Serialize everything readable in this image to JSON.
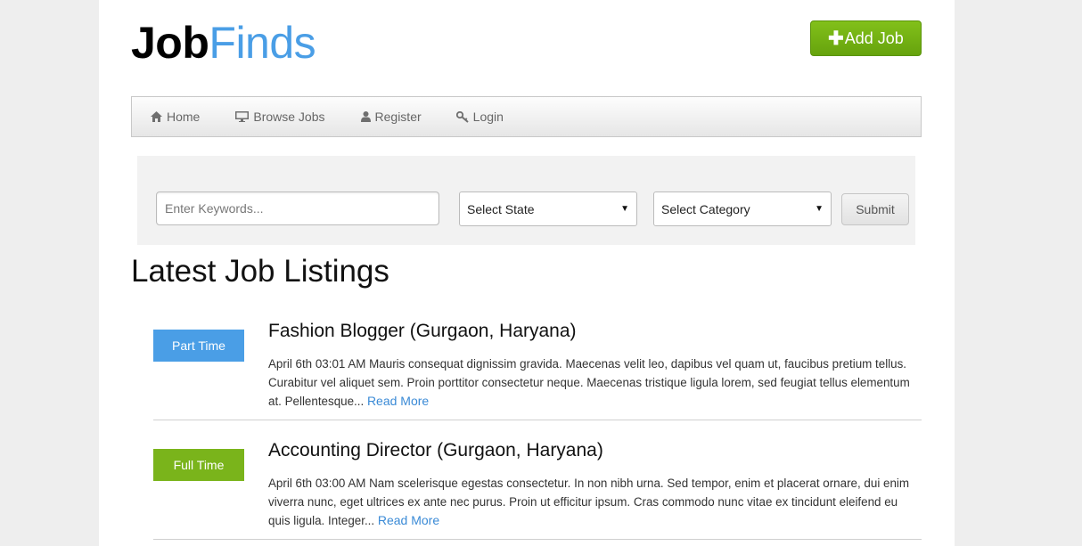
{
  "header": {
    "logo_part1": "Job",
    "logo_part2": "Finds",
    "add_job_icon": "plus-icon",
    "add_job_label": "Add Job"
  },
  "nav": {
    "items": [
      {
        "label": "Home",
        "icon": "home-icon"
      },
      {
        "label": "Browse Jobs",
        "icon": "monitor-icon"
      },
      {
        "label": "Register",
        "icon": "user-icon"
      },
      {
        "label": "Login",
        "icon": "key-icon"
      }
    ]
  },
  "search": {
    "keywords_placeholder": "Enter Keywords...",
    "keywords_value": "",
    "state_selected": "Select State",
    "category_selected": "Select Category",
    "submit_label": "Submit"
  },
  "listings": {
    "title": "Latest Job Listings",
    "jobs": [
      {
        "badge": "Part Time",
        "badge_color": "#4a9ee6",
        "title": "Fashion Blogger (Gurgaon, Haryana)",
        "description": "April 6th 03:01 AM Mauris consequat dignissim gravida. Maecenas velit leo, dapibus vel quam ut, faucibus pretium tellus. Curabitur vel aliquet sem. Proin porttitor consectetur neque. Maecenas tristique ligula lorem, sed feugiat tellus elementum at. Pellentesque...",
        "read_more": "Read More"
      },
      {
        "badge": "Full Time",
        "badge_color": "#7ab41b",
        "title": "Accounting Director (Gurgaon, Haryana)",
        "description": "April 6th 03:00 AM Nam scelerisque egestas consectetur. In non nibh urna. Sed tempor, enim et placerat ornare, dui enim viverra nunc, eget ultrices ex ante nec purus. Proin ut efficitur ipsum. Cras commodo nunc vitae ex tincidunt eleifend eu quis ligula. Integer...",
        "read_more": "Read More"
      }
    ]
  }
}
